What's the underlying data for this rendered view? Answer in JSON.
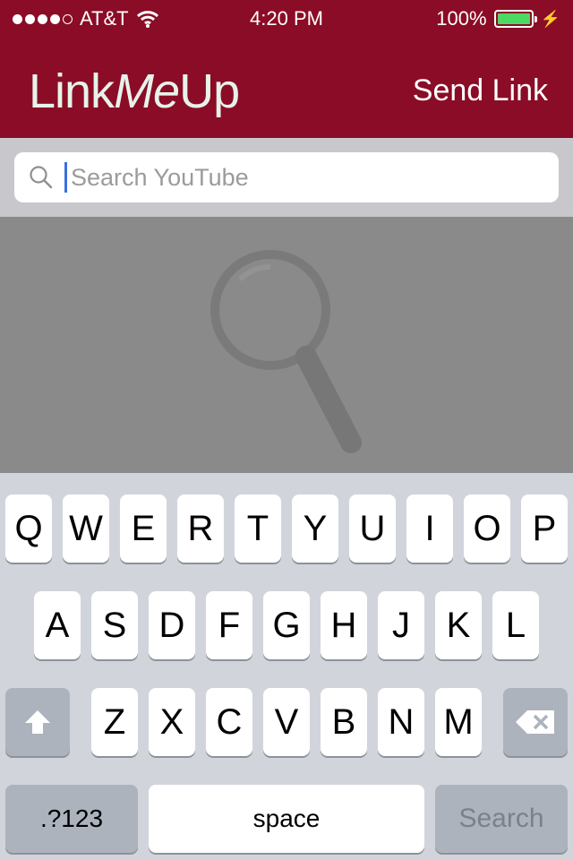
{
  "status_bar": {
    "carrier": "AT&T",
    "time": "4:20 PM",
    "battery": "100%"
  },
  "nav": {
    "logo_link": "Link",
    "logo_me": "Me",
    "logo_up": "Up",
    "send_link_label": "Send Link"
  },
  "search": {
    "placeholder": "Search YouTube",
    "value": ""
  },
  "keyboard": {
    "row1": [
      "Q",
      "W",
      "E",
      "R",
      "T",
      "Y",
      "U",
      "I",
      "O",
      "P"
    ],
    "row2": [
      "A",
      "S",
      "D",
      "F",
      "G",
      "H",
      "J",
      "K",
      "L"
    ],
    "row3": [
      "Z",
      "X",
      "C",
      "V",
      "B",
      "N",
      "M"
    ],
    "numbers_label": ".?123",
    "space_label": "space",
    "search_label": "Search"
  },
  "colors": {
    "header": "#8b0c26",
    "logo_text": "#e6f3ea",
    "results_bg": "#8a8a8a",
    "keyboard_bg": "#d1d5db",
    "caret": "#3b6fe0"
  }
}
